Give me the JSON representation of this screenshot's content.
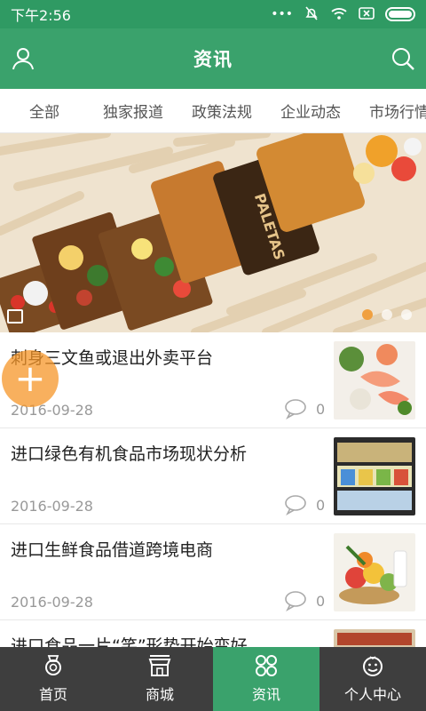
{
  "status_bar": {
    "time": "下午2:56",
    "icons": [
      "more-icon",
      "mute-icon",
      "wifi-icon",
      "sim-icon",
      "battery-icon"
    ]
  },
  "header": {
    "title": "资讯",
    "left_icon": "user-icon",
    "right_icon": "search-icon"
  },
  "tabs": [
    {
      "label": "全部"
    },
    {
      "label": "独家报道"
    },
    {
      "label": "政策法规"
    },
    {
      "label": "企业动态"
    },
    {
      "label": "市场行情"
    }
  ],
  "banner": {
    "text": "PALETAS",
    "dots": [
      true,
      false,
      false
    ]
  },
  "articles": [
    {
      "title": "刺身三文鱼或退出外卖平台",
      "date": "2016-09-28",
      "comments": "0"
    },
    {
      "title": "进口绿色有机食品市场现状分析",
      "date": "2016-09-28",
      "comments": "0"
    },
    {
      "title": "进口生鲜食品借道跨境电商",
      "date": "2016-09-28",
      "comments": "0"
    },
    {
      "title": "进口食品一片“笑”形势开始变好",
      "date": "",
      "comments": ""
    }
  ],
  "fab": {
    "label": "+"
  },
  "bottom_nav": [
    {
      "label": "首页",
      "icon": "medal-icon",
      "active": false
    },
    {
      "label": "商城",
      "icon": "store-icon",
      "active": false
    },
    {
      "label": "资讯",
      "icon": "grid-icon",
      "active": true
    },
    {
      "label": "个人中心",
      "icon": "smile-icon",
      "active": false
    }
  ],
  "colors": {
    "primary": "#3aa26c",
    "status_bar": "#2f9a63",
    "bottom_nav": "#3e3e3e",
    "fab": "#f59628"
  }
}
